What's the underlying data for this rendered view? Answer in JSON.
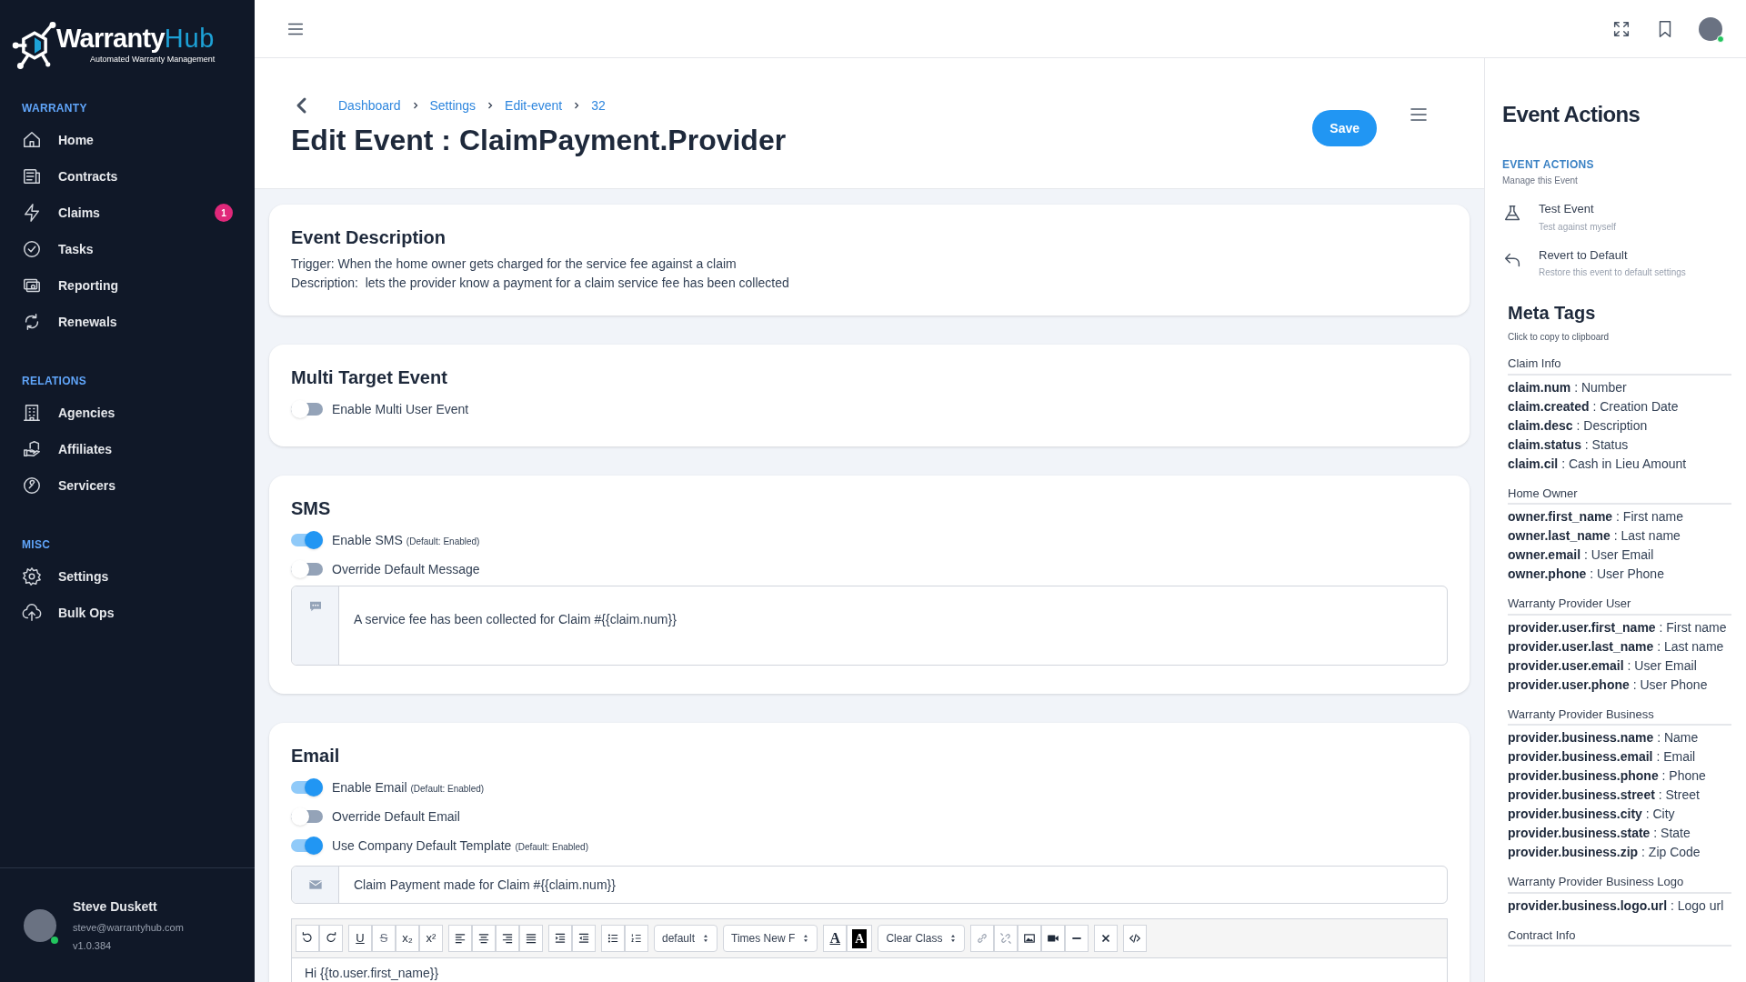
{
  "brand": {
    "name_main": "Warranty",
    "name_accent": "Hub",
    "tagline": "Automated Warranty Management"
  },
  "sidebar": {
    "sections": [
      {
        "title": "WARRANTY",
        "items": [
          {
            "label": "Home",
            "selected": false
          },
          {
            "label": "Contracts",
            "selected": false
          },
          {
            "label": "Claims",
            "selected": false,
            "badge": "1"
          },
          {
            "label": "Tasks",
            "selected": false
          },
          {
            "label": "Reporting",
            "selected": false
          },
          {
            "label": "Renewals",
            "selected": false
          }
        ]
      },
      {
        "title": "RELATIONS",
        "items": [
          {
            "label": "Agencies",
            "selected": false
          },
          {
            "label": "Affiliates",
            "selected": false
          },
          {
            "label": "Servicers",
            "selected": false
          }
        ]
      },
      {
        "title": "MISC",
        "items": [
          {
            "label": "Settings",
            "selected": false
          },
          {
            "label": "Bulk Ops",
            "selected": false
          }
        ]
      }
    ],
    "user": {
      "name": "Steve Duskett",
      "email": "steve@warrantyhub.com",
      "version": "v1.0.384",
      "online": true
    }
  },
  "page_header": {
    "breadcrumb": [
      "Dashboard",
      "Settings",
      "Edit-event",
      "32"
    ],
    "title": "Edit Event : ClaimPayment.Provider",
    "save_button": "Save"
  },
  "event_description": {
    "title": "Event Description",
    "lines": [
      "Trigger: When the home owner gets charged for the service fee against a claim",
      "Description:  lets the provider know a payment for a claim service fee has been collected"
    ]
  },
  "multi_target": {
    "title": "Multi Target Event",
    "toggles": [
      {
        "label": "Enable Multi User Event",
        "on": false
      }
    ]
  },
  "sms": {
    "title": "SMS",
    "toggles": [
      {
        "label": "Enable SMS",
        "note": "(Default: Enabled)",
        "on": true
      },
      {
        "label": "Override Default Message",
        "on": false
      }
    ],
    "message": "A service fee has been collected for Claim #{{claim.num}}"
  },
  "email": {
    "title": "Email",
    "toggles": [
      {
        "label": "Enable Email",
        "note": "(Default: Enabled)",
        "on": true
      },
      {
        "label": "Override Default Email",
        "on": false
      },
      {
        "label": "Use Company Default Template",
        "note": "(Default: Enabled)",
        "on": true
      }
    ],
    "subject": "Claim Payment made for Claim #{{claim.num}}",
    "toolbar": [
      [
        {
          "kind": "undo"
        },
        {
          "kind": "redo"
        }
      ],
      [
        {
          "kind": "underline",
          "label": "U"
        },
        {
          "kind": "strike",
          "label": "S"
        },
        {
          "kind": "subscript",
          "label": "x₂"
        },
        {
          "kind": "superscript",
          "label": "x²"
        }
      ],
      [
        {
          "kind": "align-left"
        },
        {
          "kind": "align-center"
        },
        {
          "kind": "align-right"
        },
        {
          "kind": "justify"
        }
      ],
      [
        {
          "kind": "indent"
        },
        {
          "kind": "outdent"
        }
      ],
      [
        {
          "kind": "bullets"
        },
        {
          "kind": "numbers"
        }
      ],
      [
        {
          "kind": "select",
          "label": "default"
        }
      ],
      [
        {
          "kind": "select",
          "label": "Times New F"
        }
      ],
      [
        {
          "kind": "font-color",
          "label": "A"
        },
        {
          "kind": "back-color",
          "label": "A"
        }
      ],
      [
        {
          "kind": "select",
          "label": "Clear Class"
        }
      ],
      [
        {
          "kind": "link"
        },
        {
          "kind": "unlink"
        },
        {
          "kind": "image"
        },
        {
          "kind": "video"
        },
        {
          "kind": "rule"
        }
      ],
      [
        {
          "kind": "clear"
        }
      ],
      [
        {
          "kind": "code"
        }
      ]
    ],
    "body": "Hi {{to.user.first_name}}"
  },
  "right_panel": {
    "title": "Event Actions",
    "section_label": "EVENT ACTIONS",
    "section_hint": "Manage this Event",
    "actions": [
      {
        "label": "Test Event",
        "hint": "Test against myself"
      },
      {
        "label": "Revert to Default",
        "hint": "Restore this event to default settings"
      }
    ],
    "meta_title": "Meta Tags",
    "meta_hint": "Click to copy to clipboard",
    "groups": [
      {
        "title": "Claim Info",
        "tags": [
          "**claim.num** : Number",
          "**claim.created** : Creation Date",
          "**claim.desc** : Description",
          "**claim.status** : Status",
          "**claim.cil** : Cash in Lieu Amount"
        ]
      },
      {
        "title": "Home Owner",
        "tags": [
          "**owner.first_name** : First name",
          "**owner.last_name** : Last name",
          "**owner.email** : User Email",
          "**owner.phone** : User Phone"
        ]
      },
      {
        "title": "Warranty Provider User",
        "tags": [
          "**provider.user.first_name** : First name",
          "**provider.user.last_name** : Last name",
          "**provider.user.email** : User Email",
          "**provider.user.phone** : User Phone"
        ]
      },
      {
        "title": "Warranty Provider Business",
        "tags": [
          "**provider.business.name** : Name",
          "**provider.business.email** : Email",
          "**provider.business.phone** : Phone",
          "**provider.business.street** : Street",
          "**provider.business.city** : City",
          "**provider.business.state** : State",
          "**provider.business.zip** : Zip Code"
        ]
      },
      {
        "title": "Warranty Provider Business Logo",
        "tags": [
          "**provider.business.logo.url** : Logo url"
        ]
      },
      {
        "title": "Contract Info"
      }
    ]
  }
}
